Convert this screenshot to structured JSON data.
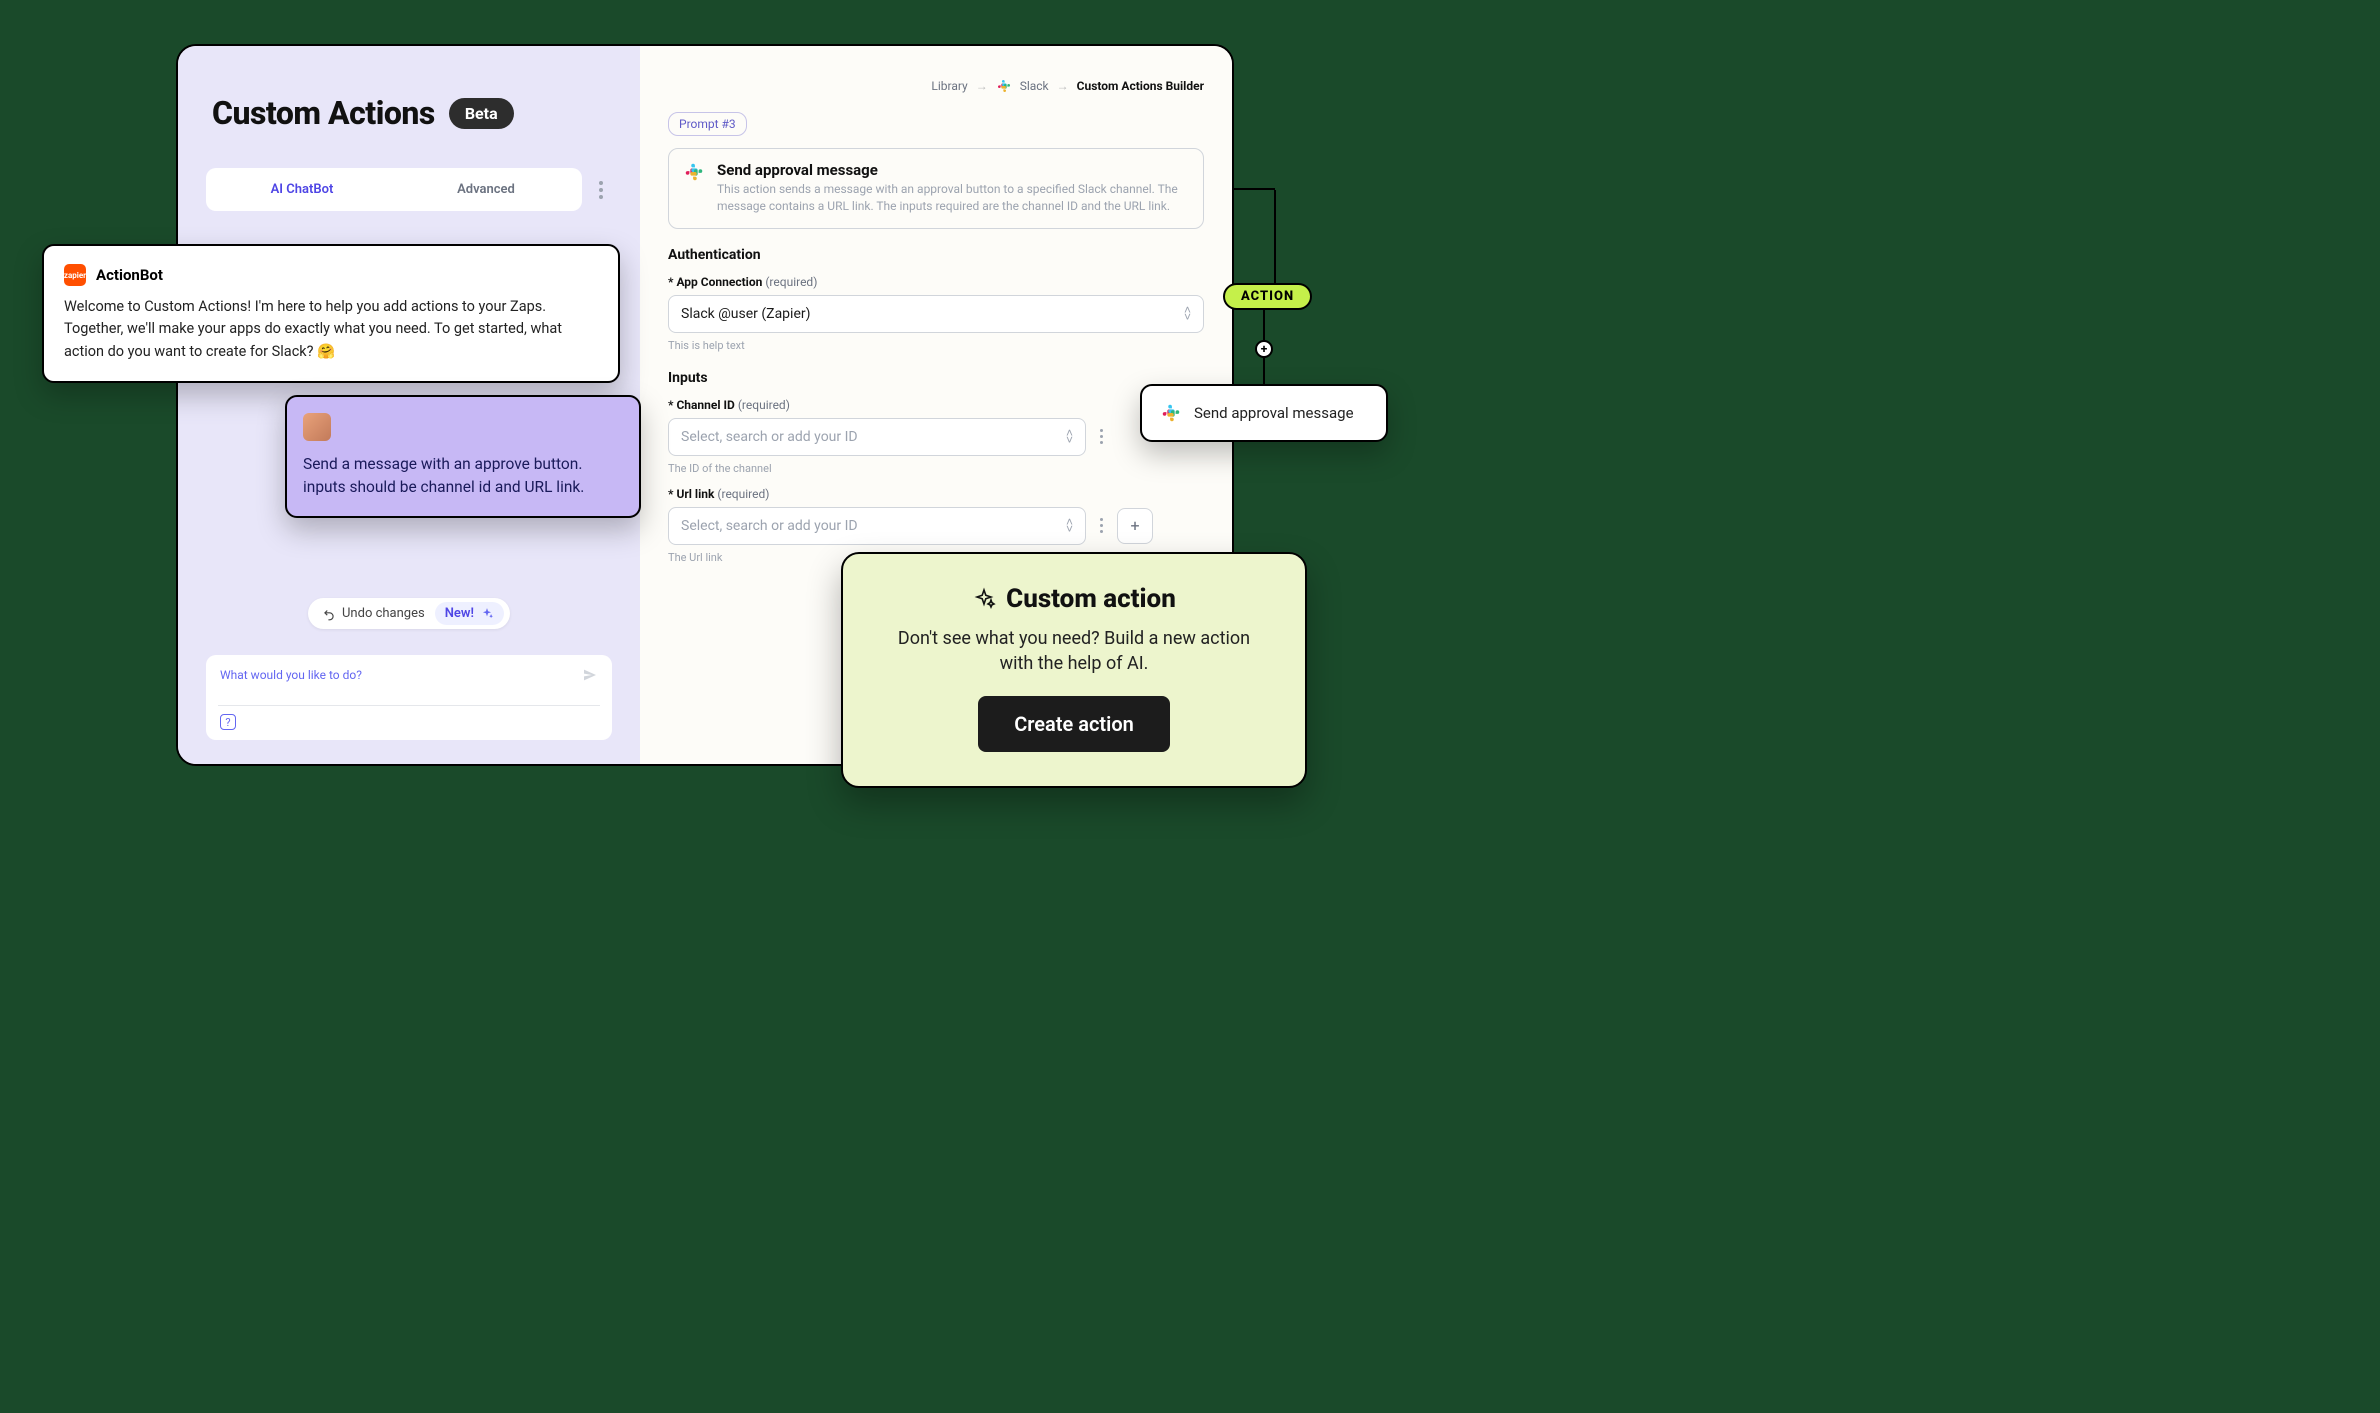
{
  "left": {
    "title": "Custom Actions",
    "beta_label": "Beta",
    "tabs": {
      "chatbot": "AI ChatBot",
      "advanced": "Advanced"
    },
    "undo": {
      "undo_label": "Undo changes",
      "new_label": "New!"
    },
    "input": {
      "placeholder": "What would you like to do?"
    }
  },
  "bot": {
    "badge_text": "zapier",
    "name": "ActionBot",
    "message": "Welcome to Custom Actions! I'm here to help you add actions to your Zaps. Together, we'll make your apps do exactly what you need. To get started, what action do you want to create for Slack? 🤗"
  },
  "user": {
    "message": "Send a message with an approve button. inputs should be channel id and URL link."
  },
  "right": {
    "breadcrumb": {
      "library": "Library",
      "app": "Slack",
      "current": "Custom Actions Builder"
    },
    "prompt_label": "Prompt #3",
    "action": {
      "title": "Send approval message",
      "description": "This action sends a message with an approval button to a specified Slack channel. The message contains a URL link. The inputs required are the channel ID and the URL link."
    },
    "auth": {
      "header": "Authentication",
      "field_label": "App Connection",
      "required": "(required)",
      "value": "Slack @user (Zapier)",
      "help": "This is help text"
    },
    "inputs": {
      "header": "Inputs",
      "channel": {
        "label": "Channel ID",
        "required": "(required)",
        "placeholder": "Select, search or add your ID",
        "help": "The ID of the channel"
      },
      "url": {
        "label": "Url link",
        "required": "(required)",
        "placeholder": "Select, search or add your ID",
        "help": "The Url link"
      }
    }
  },
  "node": {
    "action_label": "ACTION",
    "title": "Send approval message",
    "plus": "+"
  },
  "cta": {
    "title": "Custom action",
    "subtitle": "Don't see what you need? Build a new action with the help of AI.",
    "button": "Create action"
  }
}
